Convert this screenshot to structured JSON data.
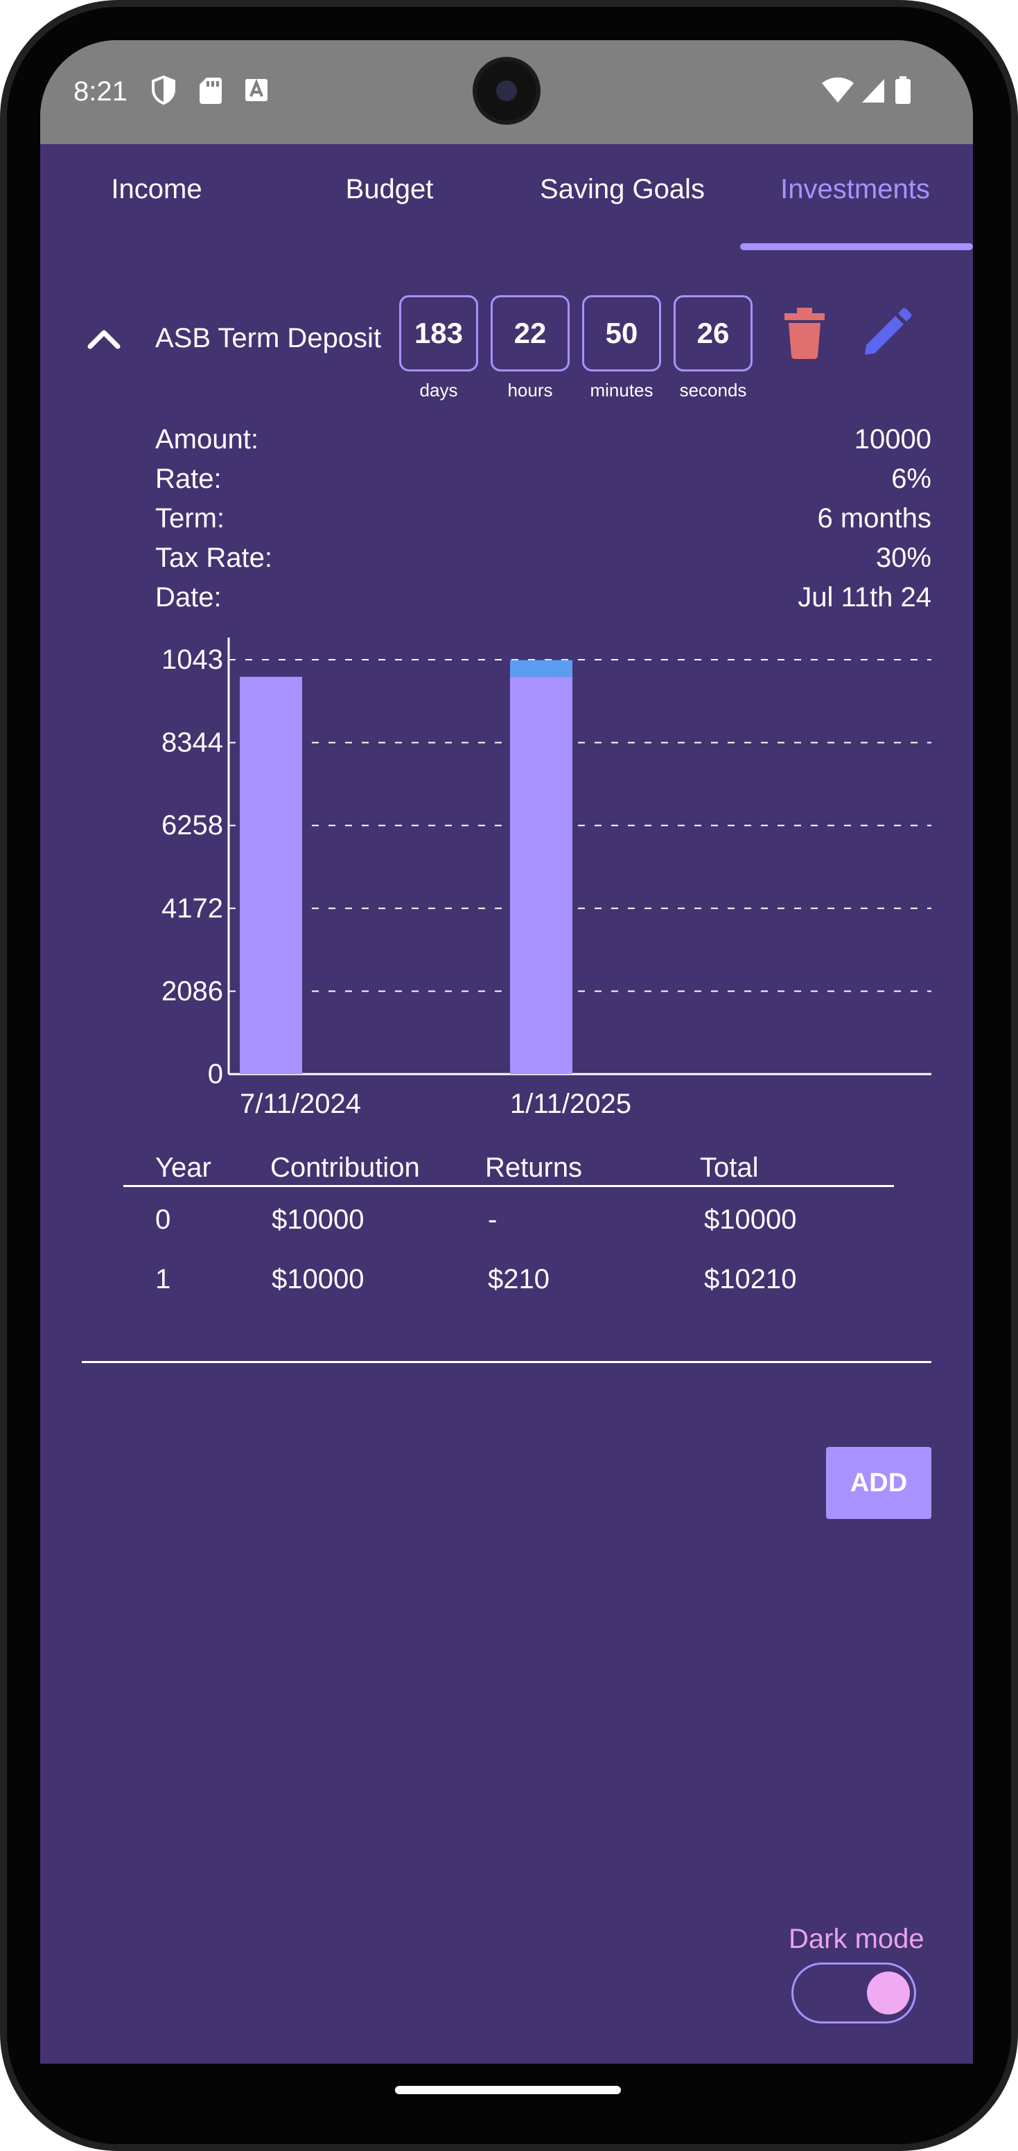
{
  "status_bar": {
    "time": "8:21"
  },
  "tabs": [
    {
      "label": "Income",
      "active": false
    },
    {
      "label": "Budget",
      "active": false
    },
    {
      "label": "Saving Goals",
      "active": false
    },
    {
      "label": "Investments",
      "active": true
    }
  ],
  "investment": {
    "title": "ASB Term Deposit",
    "countdown": [
      {
        "value": "183",
        "unit": "days"
      },
      {
        "value": "22",
        "unit": "hours"
      },
      {
        "value": "50",
        "unit": "minutes"
      },
      {
        "value": "26",
        "unit": "seconds"
      }
    ],
    "details": [
      {
        "label": "Amount:",
        "value": "10000"
      },
      {
        "label": "Rate:",
        "value": "6%"
      },
      {
        "label": "Term:",
        "value": "6 months"
      },
      {
        "label": "Tax Rate:",
        "value": "30%"
      },
      {
        "label": "Date:",
        "value": "Jul 11th 24"
      }
    ]
  },
  "chart_data": {
    "type": "bar",
    "stacked": true,
    "categories": [
      "7/11/2024",
      "1/11/2025"
    ],
    "series": [
      {
        "values": [
          10000,
          10000
        ],
        "color": "#a892ff"
      },
      {
        "values": [
          0,
          420
        ],
        "color": "#5c9cf0"
      }
    ],
    "y_ticks": [
      "0",
      "2086",
      "4172",
      "6258",
      "8344",
      "1043"
    ],
    "ylim": [
      0,
      10430
    ],
    "grid": true,
    "title": "",
    "xlabel": "",
    "ylabel": ""
  },
  "table": {
    "headers": [
      "Year",
      "Contribution",
      "Returns",
      "Total"
    ],
    "rows": [
      [
        "0",
        "$10000",
        "-",
        "$10000"
      ],
      [
        "1",
        "$10000",
        "$210",
        "$10210"
      ]
    ]
  },
  "add_button": "ADD",
  "dark_mode": {
    "label": "Dark mode",
    "on": true
  },
  "colors": {
    "background": "#433370",
    "accent": "#a892ff",
    "returns": "#5c9cf0",
    "delete": "#e07070",
    "edit": "#5c67f0",
    "dark_mode_label": "#e8a3ea"
  }
}
